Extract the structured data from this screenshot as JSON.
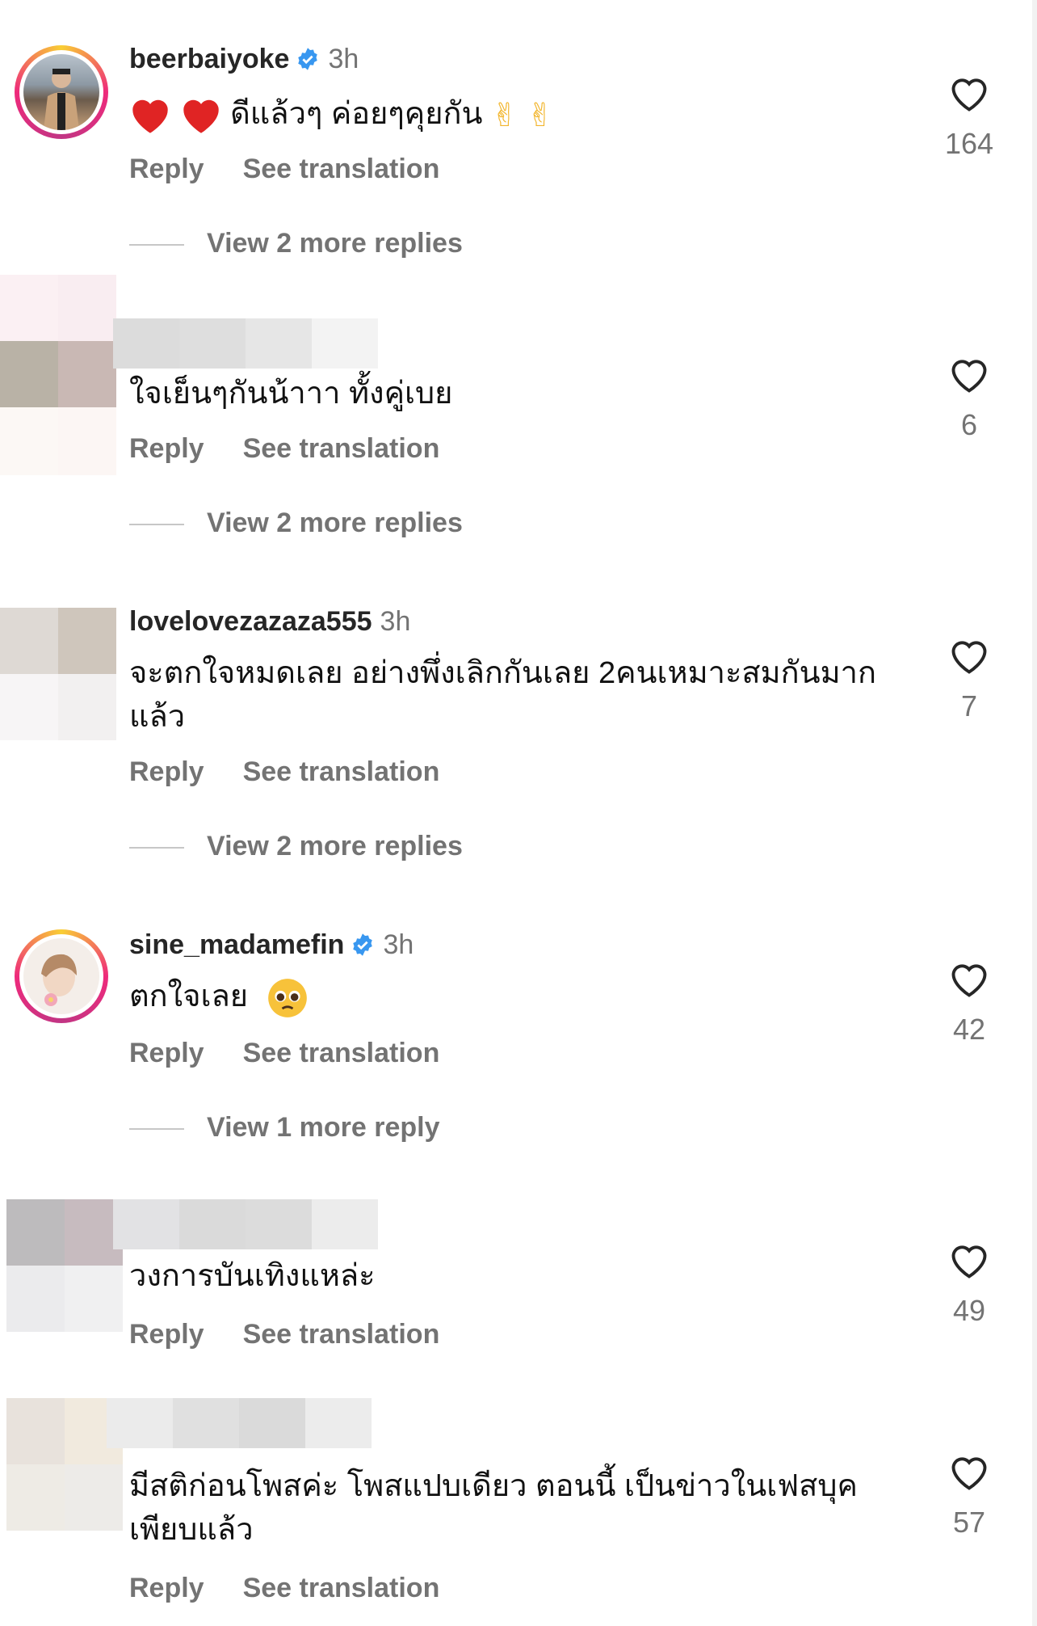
{
  "colors": {
    "accent_blue": "#3897f0",
    "muted": "#737373",
    "heart_red": "#e02424"
  },
  "actions": {
    "reply": "Reply",
    "translate": "See translation"
  },
  "comments": [
    {
      "username": "beerbaiyoke",
      "verified": true,
      "time": "3h",
      "text": "ดีแล้วๆ ค่อยๆคุยกัน",
      "likes": "164",
      "more_replies": "View 2 more replies"
    },
    {
      "username": "",
      "verified": false,
      "time": "",
      "text": "ใจเย็นๆกันน้าาา ทั้งคู่เบย",
      "likes": "6",
      "more_replies": "View 2 more replies"
    },
    {
      "username": "lovelovezazaza555",
      "verified": false,
      "time": "3h",
      "text": "จะตกใจหมดเลย อย่างพึ่งเลิกกันเลย 2คนเหมาะสมกันมากแล้ว",
      "likes": "7",
      "more_replies": "View 2 more replies"
    },
    {
      "username": "sine_madamefin",
      "verified": true,
      "time": "3h",
      "text": "ตกใจเลย",
      "likes": "42",
      "more_replies": "View 1 more reply"
    },
    {
      "username": "",
      "verified": false,
      "time": "",
      "text": "วงการบันเทิงแหล่ะ",
      "likes": "49",
      "more_replies": ""
    },
    {
      "username": "",
      "verified": false,
      "time": "",
      "text": "มีสติก่อนโพสค่ะ  โพสแปบเดียว ตอนนี้ เป็นข่าวในเฟสบุคเพียบแล้ว",
      "likes": "57",
      "more_replies": ""
    }
  ],
  "icons": {
    "like": "heart-outline-icon",
    "verified": "verified-badge-icon",
    "emoji_victory": "victory-hand-icon",
    "emoji_pleading": "pleading-face-icon",
    "emoji_heart": "red-heart-icon"
  }
}
